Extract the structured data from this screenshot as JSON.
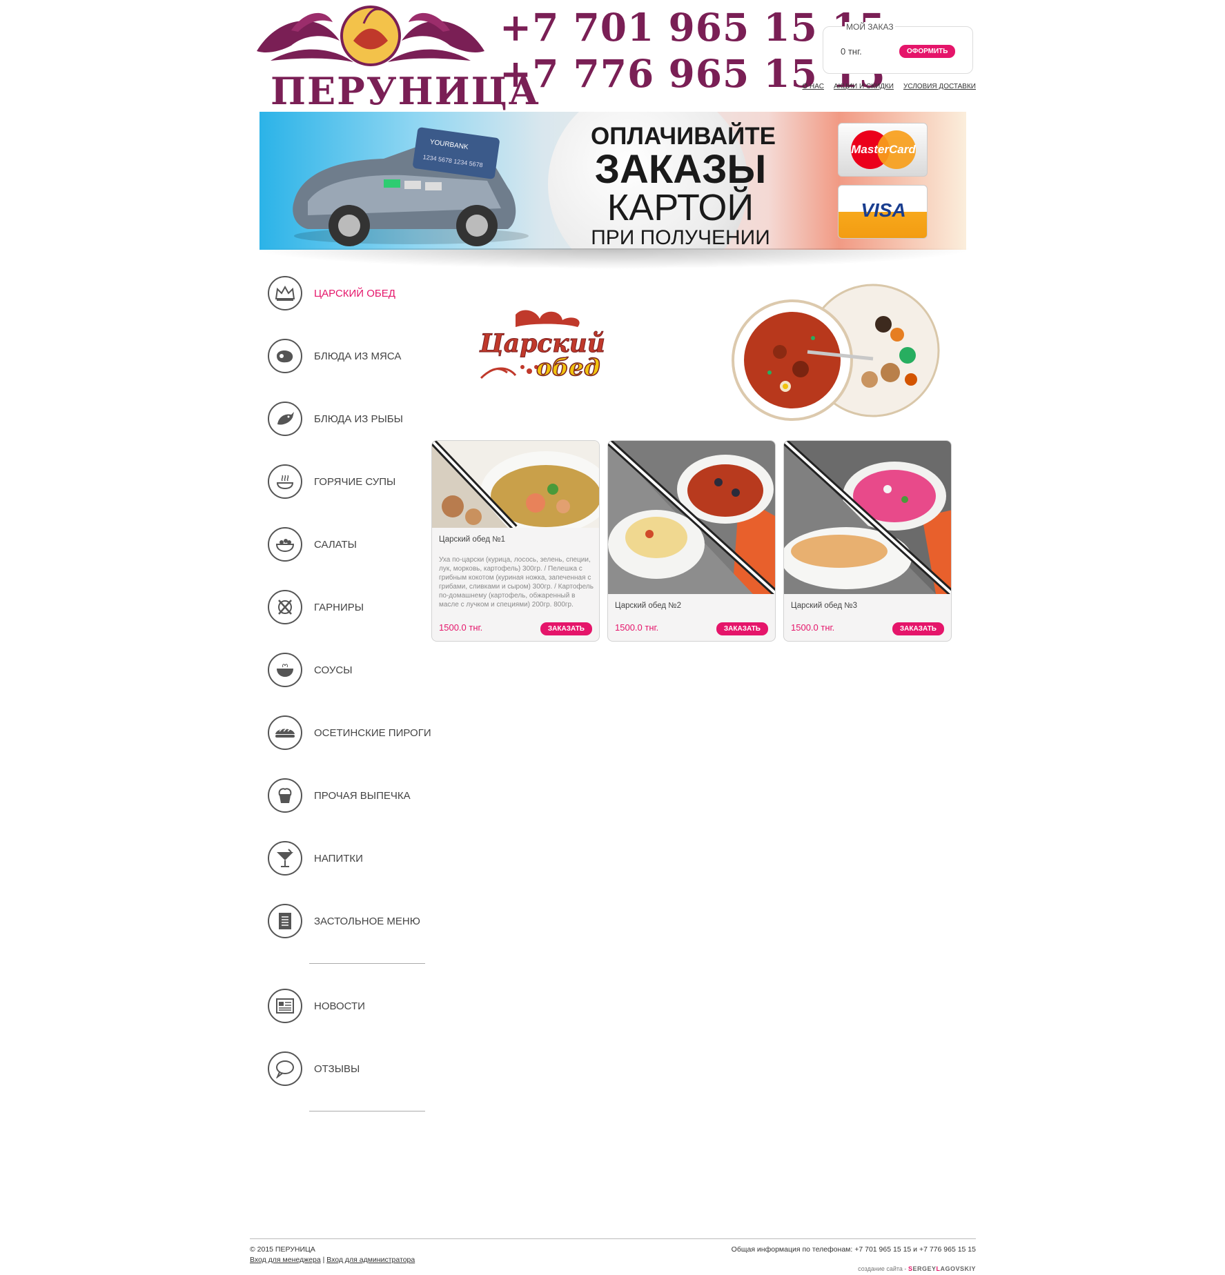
{
  "header": {
    "logo_text": "ПЕРУНИЦА",
    "phones": [
      "+7 701 965 15 15",
      "+7 776 965 15 15"
    ],
    "order": {
      "title": "МОЙ ЗАКАЗ",
      "total": "0 тнг.",
      "checkout_label": "ОФОРМИТЬ"
    },
    "nav": [
      "О НАС",
      "АКЦИИ И СКИДКИ",
      "УСЛОВИЯ ДОСТАВКИ"
    ]
  },
  "banner": {
    "lines": [
      "ОПЛАЧИВАЙТЕ",
      "ЗАКАЗЫ",
      "КАРТОЙ",
      "ПРИ ПОЛУЧЕНИИ"
    ],
    "card_bank": "YOURBANK",
    "card_number": "1234 5678 1234 5678",
    "cards": [
      "MasterCard",
      "VISA"
    ]
  },
  "sidebar": {
    "items": [
      {
        "label": "ЦАРСКИЙ ОБЕД",
        "icon": "crown-icon",
        "active": true
      },
      {
        "label": "БЛЮДА ИЗ МЯСА",
        "icon": "steak-icon"
      },
      {
        "label": "БЛЮДА ИЗ РЫБЫ",
        "icon": "fish-icon"
      },
      {
        "label": "ГОРЯЧИЕ СУПЫ",
        "icon": "soup-icon"
      },
      {
        "label": "САЛАТЫ",
        "icon": "salad-icon"
      },
      {
        "label": "ГАРНИРЫ",
        "icon": "cutlery-icon"
      },
      {
        "label": "СОУСЫ",
        "icon": "sauce-icon"
      },
      {
        "label": "ОСЕТИНСКИЕ ПИРОГИ",
        "icon": "pie-icon"
      },
      {
        "label": "ПРОЧАЯ ВЫПЕЧКА",
        "icon": "cupcake-icon"
      },
      {
        "label": "НАПИТКИ",
        "icon": "cocktail-icon"
      },
      {
        "label": "ЗАСТОЛЬНОЕ МЕНЮ",
        "icon": "menu-icon"
      }
    ],
    "extra": [
      {
        "label": "НОВОСТИ",
        "icon": "news-icon"
      },
      {
        "label": "ОТЗЫВЫ",
        "icon": "chat-icon"
      }
    ]
  },
  "category": {
    "logo_text": [
      "Царский",
      "обед"
    ]
  },
  "products": [
    {
      "name": "Царский обед №1",
      "description": "Уха по-царски (курица, лосось, зелень, специи, лук, морковь, картофель) 300гр. / Пелешка с грибным кокотом (куриная ножка, запеченная с грибами, сливками и сыром) 300гр. / Картофель по-домашнему (картофель, обжаренный в масле с лучком и специями) 200гр. 800гр.",
      "price": "1500.0 тнг.",
      "button": "ЗАКАЗАТЬ"
    },
    {
      "name": "Царский обед №2",
      "price": "1500.0 тнг.",
      "button": "ЗАКАЗАТЬ"
    },
    {
      "name": "Царский обед №3",
      "price": "1500.0 тнг.",
      "button": "ЗАКАЗАТЬ"
    }
  ],
  "footer": {
    "copyright": "© 2015 ПЕРУНИЦА",
    "manager_link": "Вход для менеджера",
    "separator": "|",
    "admin_link": "Вход для администратора",
    "info": "Общая информация по телефонам: +7 701 965 15 15 и +7 776 965 15 15",
    "credit_prefix": "создание сайта -",
    "credit_a": "SERGEY",
    "credit_b": "L",
    "credit_c": "AGOVSKIY"
  },
  "colors": {
    "brand": "#7a1f55",
    "accent": "#e5156a"
  }
}
